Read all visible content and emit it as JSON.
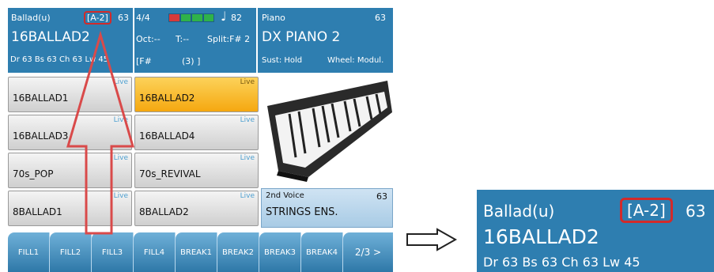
{
  "style_header": {
    "style_label": "Ballad(u)",
    "variation": "[A-2]",
    "tempo_num": "63",
    "style_name": "16BALLAD2",
    "volumes": "Dr 63  Bs 63  Ch 63  Lw 45"
  },
  "mid_header": {
    "time_sig": "4/4",
    "note_symbol": "♩",
    "tempo": "82",
    "oct": "Oct:--",
    "transpose": "T:--",
    "split": "Split:F# 2",
    "chord": "[F#",
    "chord_num": "(3) ]",
    "level_colors": [
      "#d63a3a",
      "#2fb24a",
      "#2fb24a",
      "#2fb24a"
    ]
  },
  "voice_header": {
    "category": "Piano",
    "volume": "63",
    "voice_name": "DX PIANO 2",
    "sustain": "Sust: Hold",
    "wheel": "Wheel: Modul."
  },
  "style_grid": [
    {
      "name": "16BALLAD1",
      "live": "Live"
    },
    {
      "name": "16BALLAD2",
      "live": "Live"
    },
    {
      "name": "16BALLAD3",
      "live": "Live"
    },
    {
      "name": "16BALLAD4",
      "live": "Live"
    },
    {
      "name": "70s_POP",
      "live": "Live"
    },
    {
      "name": "70s_REVIVAL",
      "live": "Live"
    },
    {
      "name": "8BALLAD1",
      "live": "Live"
    },
    {
      "name": "8BALLAD2",
      "live": "Live"
    }
  ],
  "second_voice": {
    "label": "2nd Voice",
    "volume": "63",
    "name": "STRINGS ENS."
  },
  "fill_buttons": [
    "FILL1",
    "FILL2",
    "FILL3",
    "FILL4",
    "BREAK1",
    "BREAK2",
    "BREAK3",
    "BREAK4",
    "2/3 >"
  ],
  "zoom_panel": {
    "style_label": "Ballad(u)",
    "variation": "[A-2]",
    "tempo_num": "63",
    "style_name": "16BALLAD2",
    "volumes": "Dr 63   Bs 63   Ch 63   Lw 45"
  },
  "colors": {
    "header_blue": "#2e7eb0",
    "selected_button": "#f5a810",
    "highlight_red": "#d22a2a"
  },
  "icons": [
    "arrow-up-icon",
    "arrow-right-icon",
    "music-note-icon",
    "keyboard-image"
  ]
}
